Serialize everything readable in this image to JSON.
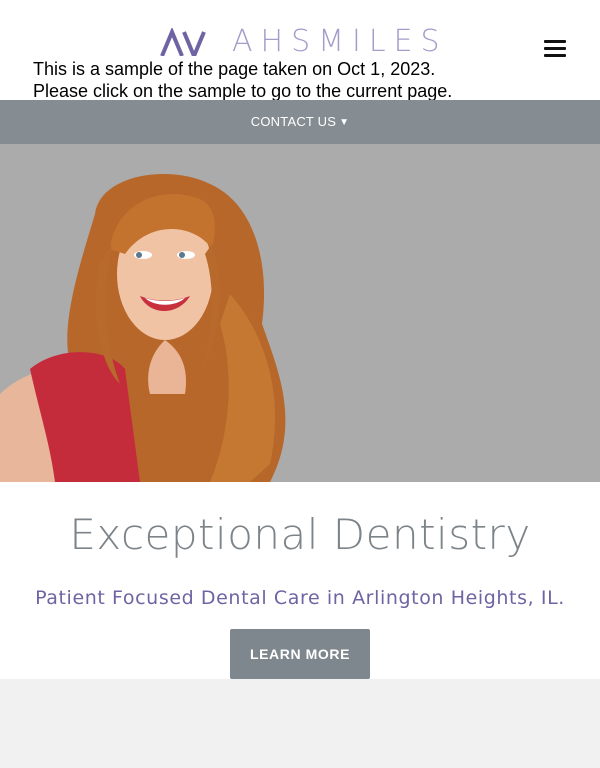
{
  "header": {
    "logo_text": "AHSMILES",
    "archive_notice_line1": "This is a sample of the page taken on Oct 1, 2023.",
    "archive_notice_line2": "Please click on the sample to go to the current page."
  },
  "contact_bar": {
    "label": "CONTACT US",
    "caret_icon": "caret-down-icon"
  },
  "hero": {
    "image": "smiling-woman-red-hair-photo"
  },
  "content": {
    "headline": "Exceptional Dentistry",
    "subheadline": "Patient Focused Dental Care in Arlington Heights, IL.",
    "cta_label": "LEARN MORE"
  },
  "colors": {
    "accent_purple": "#6f64a3",
    "bar_gray": "#858c92",
    "hero_gray": "#ababab",
    "headline_gray": "#7d8489"
  }
}
